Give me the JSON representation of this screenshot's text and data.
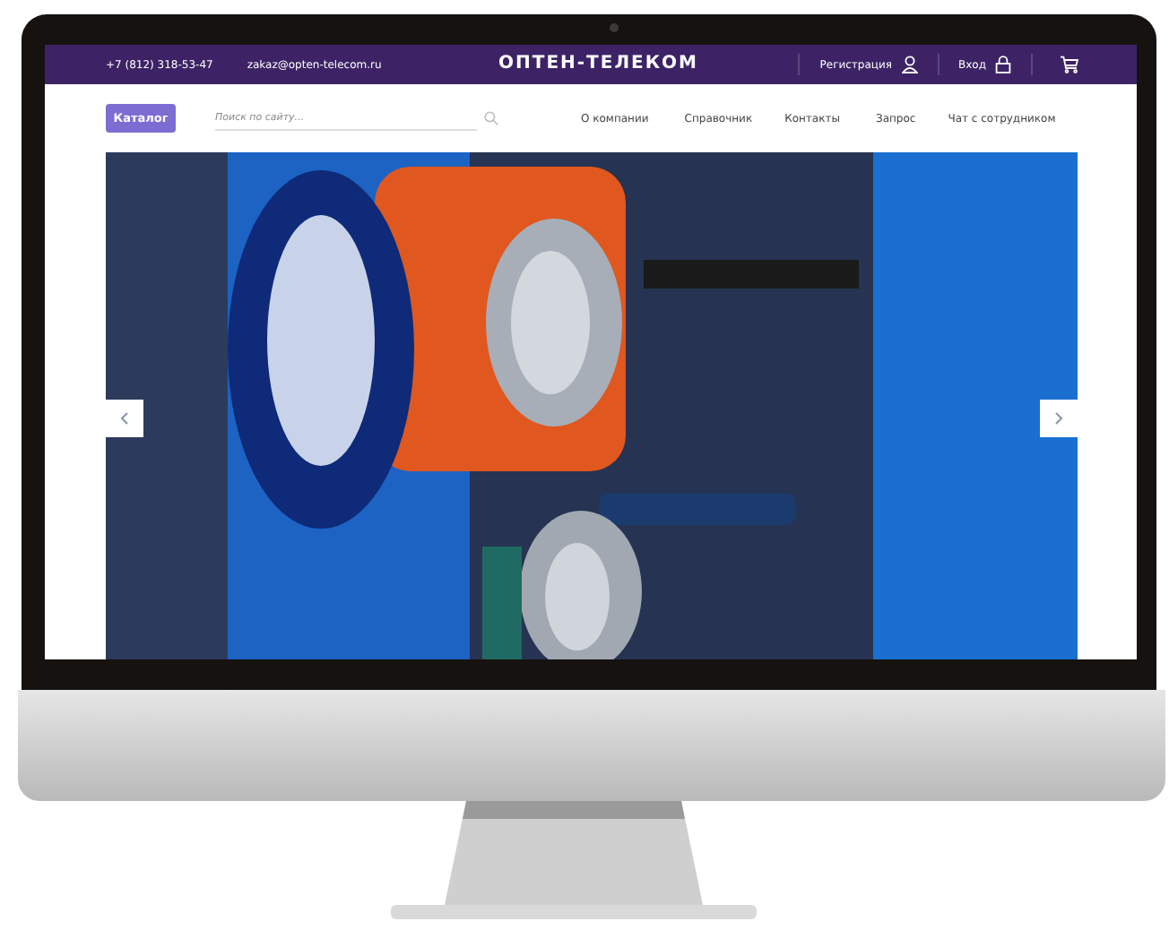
{
  "header": {
    "phone": "+7 (812) 318-53-47",
    "email": "zakaz@opten-telecom.ru",
    "logo": "ОПТЕН-ТЕЛЕКОМ",
    "register": "Регистрация",
    "login": "Вход"
  },
  "nav": {
    "catalog_button": "Каталог",
    "search": {
      "placeholder": "Поиск по сайту..."
    },
    "links": [
      "О компании",
      "Справочник",
      "Контакты",
      "Запрос",
      "Чат с сотрудником"
    ]
  }
}
